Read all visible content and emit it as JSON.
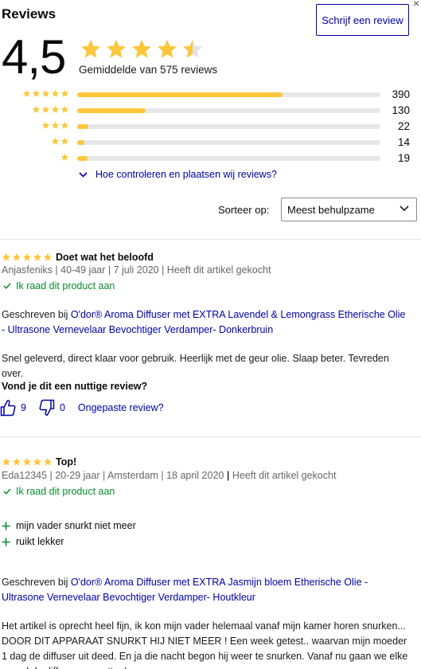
{
  "header": {
    "title": "Reviews",
    "write_button": "Schrijf een review",
    "close_glyph": "×"
  },
  "summary": {
    "average": "4,5",
    "average_rating": 4.5,
    "label": "Gemiddelde van 575 reviews"
  },
  "distribution": [
    {
      "stars": 5,
      "count": "390",
      "fraction": 0.678
    },
    {
      "stars": 4,
      "count": "130",
      "fraction": 0.226
    },
    {
      "stars": 3,
      "count": "22",
      "fraction": 0.038
    },
    {
      "stars": 2,
      "count": "14",
      "fraction": 0.024
    },
    {
      "stars": 1,
      "count": "19",
      "fraction": 0.033
    }
  ],
  "how_link": "Hoe controleren en plaatsen wij reviews?",
  "sort": {
    "label": "Sorteer op:",
    "selected": "Meest behulpzame"
  },
  "colors": {
    "star": "#fcc73c",
    "star_empty": "#e3e3e3",
    "link": "#0000a4",
    "recommend": "#0a8a2e"
  },
  "reviews": [
    {
      "rating": 5,
      "title": "Doet wat het beloofd",
      "author": "Anjasfeniks",
      "meta_rest": " | 40-49 jaar | 7 juli 2020 | Heeft dit artikel gekocht",
      "recommend": "Ik raad dit product aan",
      "written_prefix": "Geschreven bij ",
      "product": "O'dor® Aroma Diffuser met EXTRA Lavendel & Lemongrass Etherische Olie - Ultrasone Vernevelaar Bevochtiger Verdamper- Donkerbruin",
      "body": "Snel geleverd, direct klaar voor gebruik. Heerlijk met de geur olie. Slaap beter. Tevreden over.",
      "helpful_question": "Vond je dit een nuttige review?",
      "likes": "9",
      "dislikes": "0",
      "report": "Ongepaste review?"
    },
    {
      "rating": 5,
      "title": "Top!",
      "meta_a": "Eda12345 | 20-29 jaar | Amsterdam | 18 april 2020 ",
      "meta_sep": "|",
      "meta_b": " Heeft dit artikel gekocht",
      "recommend": "Ik raad dit product aan",
      "pros": [
        "mijn vader snurkt niet meer",
        "ruikt lekker"
      ],
      "written_prefix": "Geschreven bij ",
      "product": "O'dor® Aroma Diffuser met EXTRA Jasmijn bloem Etherische Olie - Ultrasone Vernevelaar Bevochtiger Verdamper- Houtkleur",
      "body": "Het artikel is oprecht heel fijn, ik kon mijn vader helemaal vanaf mijn kamer horen snurken... DOOR DIT APPARAAT SNURKT HIJ NIET MEER ! Een week getest.. waarvan mijn moeder 1 dag de diffuser uit deed. En ja die nacht begon hij weer te snurken. Vanaf nu gaan we elke avond de diffuser aanzetten!"
    }
  ]
}
